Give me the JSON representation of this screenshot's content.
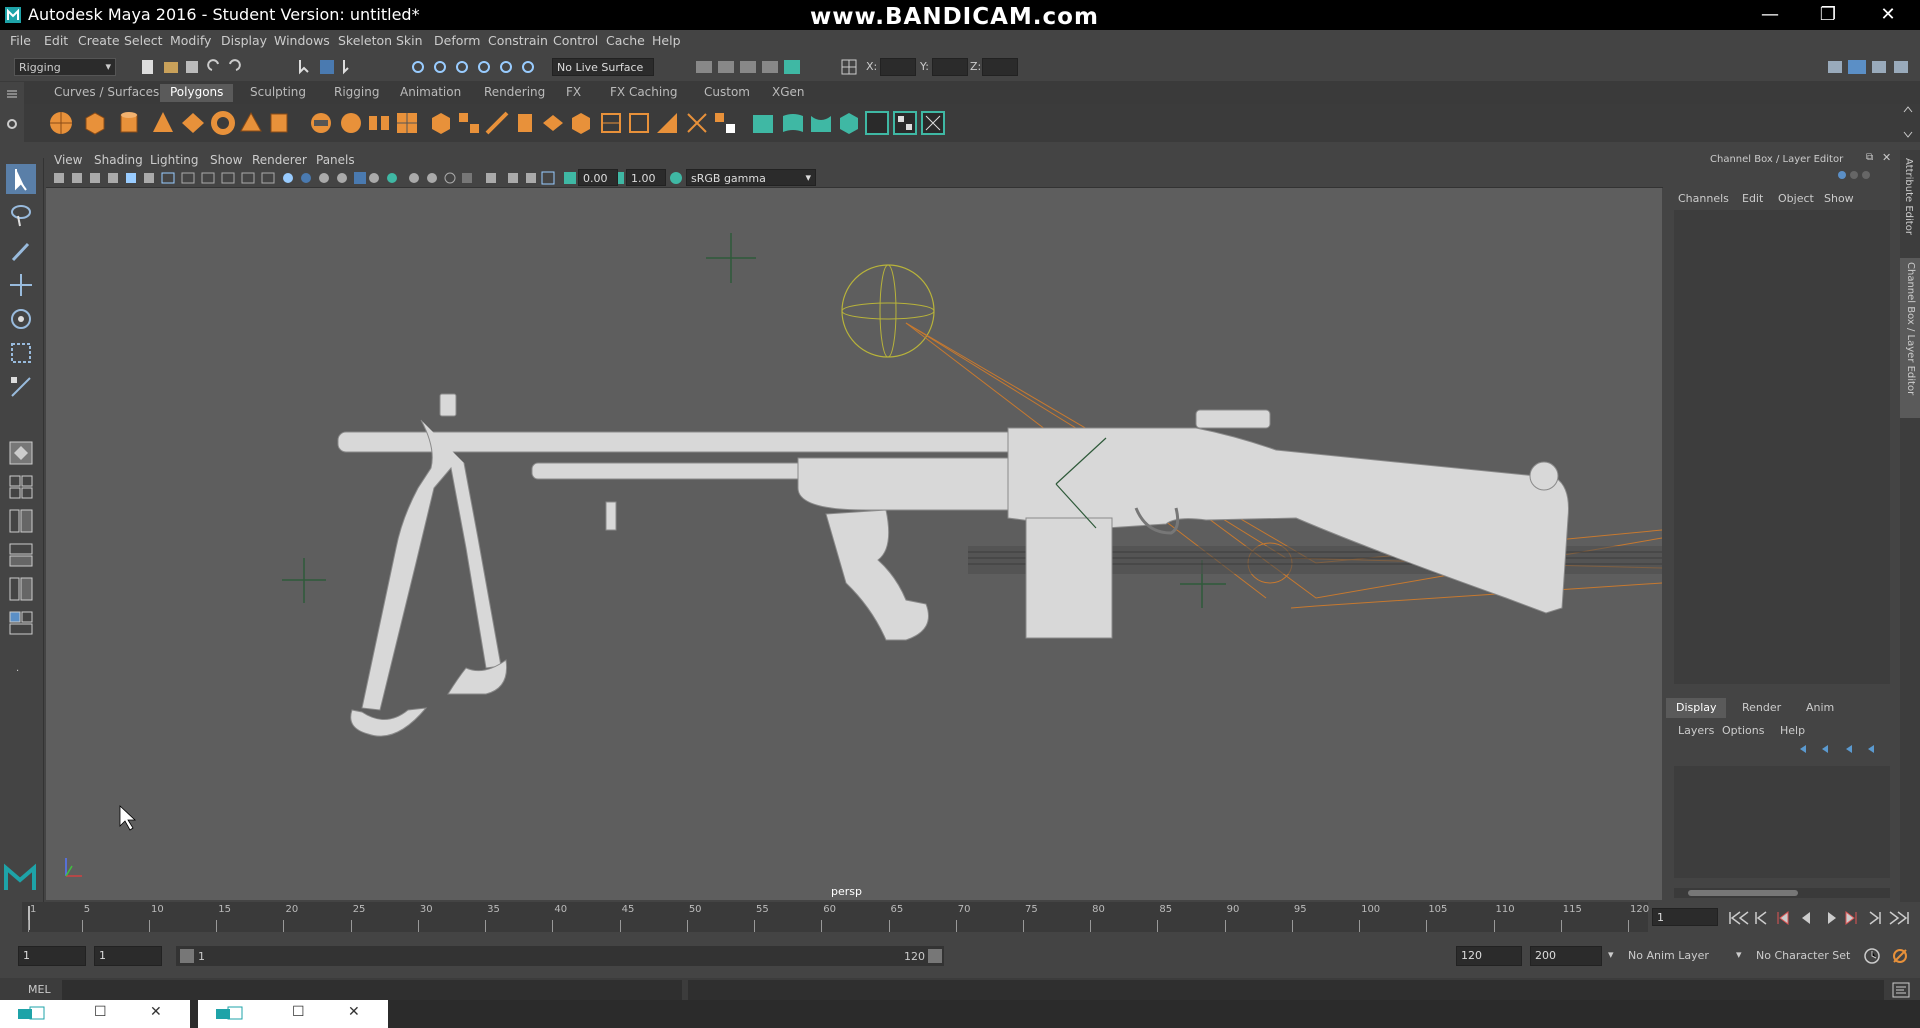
{
  "app": {
    "title": "Autodesk Maya 2016 - Student Version: untitled*",
    "watermark": "www.BANDICAM.com",
    "minimize": "—",
    "restore": "❐",
    "close": "✕"
  },
  "menu": [
    "File",
    "Edit",
    "Create",
    "Select",
    "Modify",
    "Display",
    "Windows",
    "Skeleton",
    "Skin",
    "Deform",
    "Constrain",
    "Control",
    "Cache",
    "Help"
  ],
  "toolbar": {
    "menuset": "Rigging",
    "live_surface": "No Live Surface",
    "x_label": "X:",
    "y_label": "Y:",
    "z_label": "Z:"
  },
  "shelf_tabs": [
    "Curves / Surfaces",
    "Polygons",
    "Sculpting",
    "Rigging",
    "Animation",
    "Rendering",
    "FX",
    "FX Caching",
    "Custom",
    "XGen"
  ],
  "shelf_active": "Polygons",
  "viewport": {
    "menus": [
      "View",
      "Shading",
      "Lighting",
      "Show",
      "Renderer",
      "Panels"
    ],
    "exposure": "0.00",
    "gamma": "1.00",
    "colorspace": "sRGB gamma",
    "camera": "persp"
  },
  "channelbox": {
    "title": "Channel Box / Layer Editor",
    "menus": [
      "Channels",
      "Edit",
      "Object",
      "Show"
    ],
    "tabs": [
      "Display",
      "Render",
      "Anim"
    ],
    "active_tab": "Display",
    "layer_menus": [
      "Layers",
      "Options",
      "Help"
    ]
  },
  "sidetabs": [
    "Attribute Editor",
    "Channel Box / Layer Editor"
  ],
  "timeline": {
    "ticks": [
      "1",
      "5",
      "10",
      "15",
      "20",
      "25",
      "30",
      "35",
      "40",
      "45",
      "50",
      "55",
      "60",
      "65",
      "70",
      "75",
      "80",
      "85",
      "90",
      "95",
      "100",
      "105",
      "110",
      "115",
      "120"
    ],
    "current_frame": "1"
  },
  "range": {
    "start": "1",
    "playback_start": "1",
    "slider_start": "1",
    "slider_end": "120",
    "end": "120",
    "anim_end": "200",
    "anim_layer": "No Anim Layer",
    "char_set": "No Character Set"
  },
  "cmd": {
    "label": "MEL"
  },
  "colors": {
    "accent_orange": "#e8913a",
    "accent_teal": "#3fb8a4",
    "viewport_bg": "#5e5e5e"
  }
}
